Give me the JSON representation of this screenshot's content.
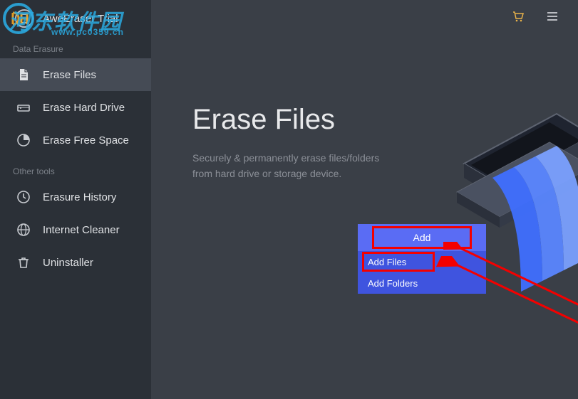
{
  "brand": {
    "title": "AweEraser Trial"
  },
  "sections": {
    "erasure": {
      "label": "Data Erasure"
    },
    "tools": {
      "label": "Other tools"
    }
  },
  "nav": {
    "erase_files": "Erase Files",
    "erase_hard_drive": "Erase Hard Drive",
    "erase_free_space": "Erase Free Space",
    "erasure_history": "Erasure History",
    "internet_cleaner": "Internet Cleaner",
    "uninstaller": "Uninstaller"
  },
  "hero": {
    "title": "Erase Files",
    "line1": "Securely & permanently erase files/folders",
    "line2": "from hard drive or storage device."
  },
  "add": {
    "button": "Add",
    "files": "Add Files",
    "folders": "Add Folders"
  },
  "watermark": {
    "main": "河东软件园",
    "sub": "www.pc0359.cn"
  },
  "colors": {
    "accent": "#5a6cf4",
    "accent_dark": "#3f54df",
    "highlight": "#f40000"
  }
}
